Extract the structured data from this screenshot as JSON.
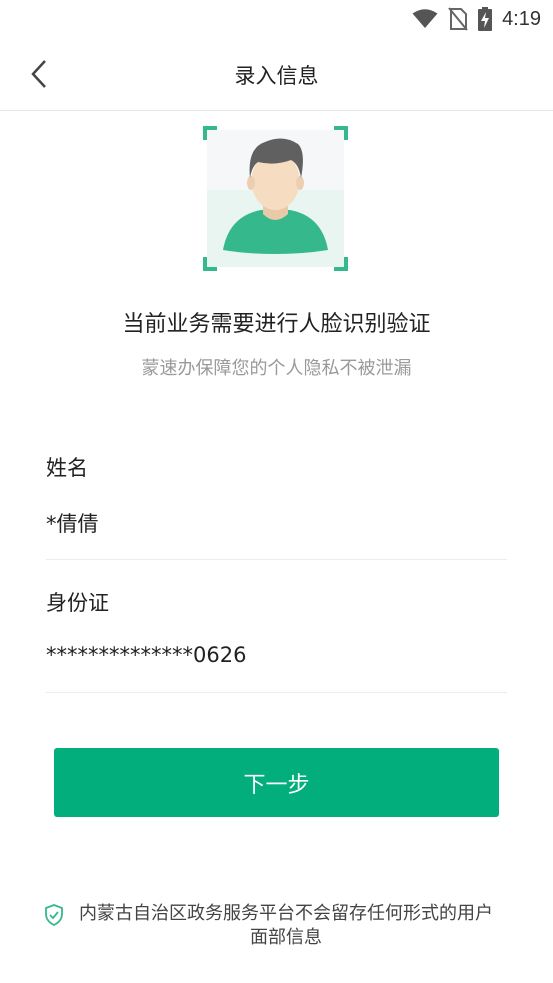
{
  "status_bar": {
    "time": "4:19",
    "icons": [
      "wifi-icon",
      "no-sim-icon",
      "battery-charging-icon"
    ]
  },
  "header": {
    "title": "录入信息",
    "back_icon": "chevron-left-icon"
  },
  "face_verification": {
    "illustration": "face-scan-icon",
    "prompt": "当前业务需要进行人脸识别验证",
    "subtitle": "蒙速办保障您的个人隐私不被泄漏"
  },
  "form": {
    "name_label": "姓名",
    "name_value": "*倩倩",
    "id_label": "身份证",
    "id_value": "**************0626"
  },
  "next_button": {
    "label": "下一步"
  },
  "privacy": {
    "icon": "shield-check-icon",
    "text": "内蒙古自治区政务服务平台不会留存任何形式的用户面部信息"
  },
  "colors": {
    "accent": "#02ae7b",
    "face_green": "#35b98c",
    "subtitle_gray": "#9a9a9a"
  }
}
